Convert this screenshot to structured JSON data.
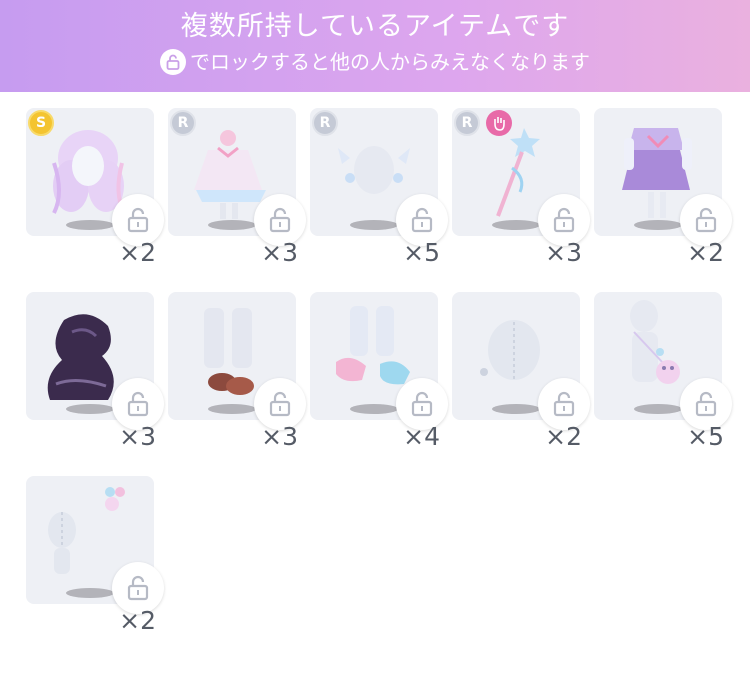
{
  "header": {
    "title": "複数所持しているアイテムです",
    "subtitle": "でロックすると他の人からみえなくなります",
    "lock_icon": "lock-icon",
    "gradient": [
      "#c69cf0",
      "#eab1df"
    ]
  },
  "items": [
    {
      "rarity": "S",
      "count": "×2",
      "kind": "hair"
    },
    {
      "rarity": "R",
      "count": "×3",
      "kind": "dress"
    },
    {
      "rarity": "R",
      "count": "×5",
      "kind": "accessory"
    },
    {
      "rarity": "R",
      "count": "×3",
      "kind": "wand",
      "badge": "hand-icon"
    },
    {
      "rarity": "",
      "count": "×2",
      "kind": "sailor-outfit"
    },
    {
      "rarity": "",
      "count": "×3",
      "kind": "dark-aura"
    },
    {
      "rarity": "",
      "count": "×3",
      "kind": "boots"
    },
    {
      "rarity": "",
      "count": "×4",
      "kind": "shoes"
    },
    {
      "rarity": "",
      "count": "×2",
      "kind": "face"
    },
    {
      "rarity": "",
      "count": "×5",
      "kind": "bag-outfit"
    },
    {
      "rarity": "",
      "count": "×2",
      "kind": "hair-clip"
    }
  ]
}
